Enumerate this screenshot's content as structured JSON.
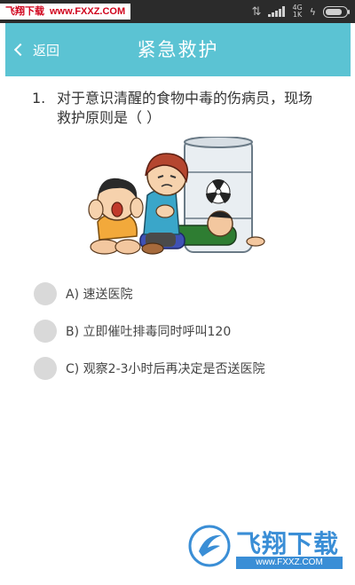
{
  "status_bar": {
    "watermark_name": "飞翔下载",
    "watermark_url": "www.FXXZ.COM",
    "network_type": "4G",
    "network_speed": "1K",
    "battery_level_percent": 90
  },
  "header": {
    "back_label": "返回",
    "title": "紧急救护"
  },
  "question": {
    "number": "1.",
    "text": "对于意识清醒的食物中毒的伤病员，现场救护原则是（ ）"
  },
  "options": [
    {
      "label": "A) 速送医院"
    },
    {
      "label": "B) 立即催吐排毒同时呼叫120"
    },
    {
      "label": "C) 观察2-3小时后再决定是否送医院"
    }
  ],
  "watermark": {
    "brand": "飞翔下载",
    "url": "www.FXXZ.COM"
  },
  "colors": {
    "header_bg": "#5bc3d3",
    "radio": "#d9d9d9",
    "watermark_blue": "#3a8ed6"
  }
}
